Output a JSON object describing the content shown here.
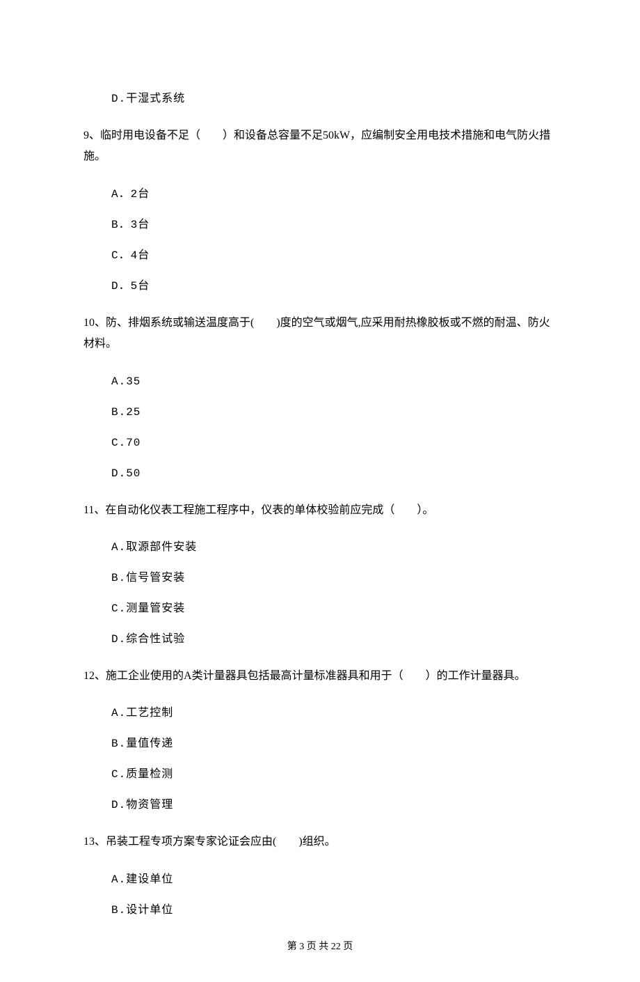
{
  "leading_option": "D.干湿式系统",
  "questions": [
    {
      "num": "9、",
      "text": "临时用电设备不足（　　）和设备总容量不足50kW，应编制安全用电技术措施和电气防火措施。",
      "options": [
        "A．2台",
        "B．3台",
        "C．4台",
        "D．5台"
      ]
    },
    {
      "num": "10、",
      "text": "防、排烟系统或输送温度高于(　　)度的空气或烟气,应采用耐热橡胶板或不燃的耐温、防火材料。",
      "options": [
        "A.35",
        "B.25",
        "C.70",
        "D.50"
      ]
    },
    {
      "num": "11、",
      "text": "在自动化仪表工程施工程序中，仪表的单体校验前应完成（　　）。",
      "options": [
        "A.取源部件安装",
        "B.信号管安装",
        "C.测量管安装",
        "D.综合性试验"
      ]
    },
    {
      "num": "12、",
      "text": "施工企业使用的A类计量器具包括最高计量标准器具和用于（　　）的工作计量器具。",
      "options": [
        "A.工艺控制",
        "B.量值传递",
        "C.质量检测",
        "D.物资管理"
      ]
    },
    {
      "num": "13、",
      "text": "吊装工程专项方案专家论证会应由(　　)组织。",
      "options": [
        "A.建设单位",
        "B.设计单位"
      ]
    }
  ],
  "footer": "第 3 页 共 22 页"
}
